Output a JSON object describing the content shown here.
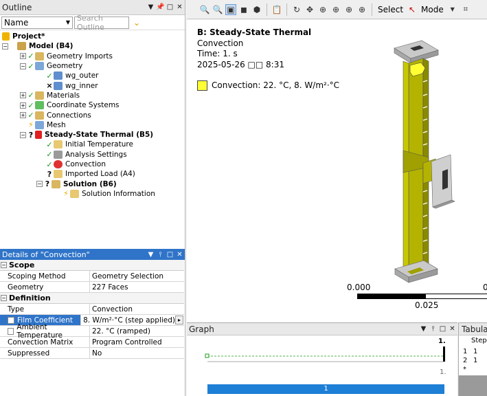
{
  "outline": {
    "title": "Outline",
    "name_field": "Name",
    "search_placeholder": "Search Outline",
    "tree": [
      {
        "label": "Project*",
        "bold": true
      },
      {
        "label": "Model (B4)",
        "bold": true
      },
      {
        "label": "Geometry Imports"
      },
      {
        "label": "Geometry"
      },
      {
        "label": "wg_outer"
      },
      {
        "label": "wg_inner"
      },
      {
        "label": "Materials"
      },
      {
        "label": "Coordinate Systems"
      },
      {
        "label": "Connections"
      },
      {
        "label": "Mesh"
      },
      {
        "label": "Steady-State Thermal (B5)",
        "bold": true
      },
      {
        "label": "Initial Temperature"
      },
      {
        "label": "Analysis Settings"
      },
      {
        "label": "Convection"
      },
      {
        "label": "Imported Load (A4)"
      },
      {
        "label": "Solution (B6)",
        "bold": true
      },
      {
        "label": "Solution Information"
      }
    ]
  },
  "details": {
    "title": "Details of \"Convection\"",
    "sections": [
      {
        "name": "Scope",
        "rows": [
          {
            "key": "Scoping Method",
            "value": "Geometry Selection"
          },
          {
            "key": "Geometry",
            "value": "227 Faces"
          }
        ]
      },
      {
        "name": "Definition",
        "rows": [
          {
            "key": "Type",
            "value": "Convection"
          },
          {
            "key": "Film Coefficient",
            "value": "8. W/m²·°C  (step applied)"
          },
          {
            "key": "Ambient Temperature",
            "value": "22. °C  (ramped)"
          },
          {
            "key": "Convection Matrix",
            "value": "Program Controlled"
          },
          {
            "key": "Suppressed",
            "value": "No"
          }
        ]
      }
    ]
  },
  "toolbar": {
    "select_label": "Select",
    "mode_label": "Mode"
  },
  "viewport": {
    "title": "B: Steady-State Thermal",
    "line1": "Convection",
    "line2": "Time: 1. s",
    "line3": "2025-05-26 □□ 8:31",
    "legend_label": "Convection: 22. °C, 8. W/m²·°C",
    "legend_color": "#ffff33",
    "scale_left": "0.000",
    "scale_mid": "0.025",
    "scale_right": "0"
  },
  "graph": {
    "title": "Graph",
    "top_value": "1.",
    "bottom_value": "1.",
    "bar_label": "1"
  },
  "tabular": {
    "title": "Tabular",
    "header": "Step",
    "rows": [
      [
        "1",
        "1"
      ],
      [
        "2",
        "1"
      ]
    ],
    "star": "*"
  }
}
